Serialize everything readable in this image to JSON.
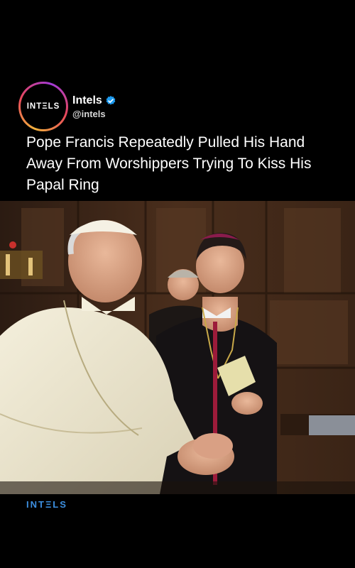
{
  "account": {
    "logo_text": "INTΞLS",
    "name": "Intels",
    "handle": "@intels",
    "verified_icon": "verified-badge-icon"
  },
  "post": {
    "headline": "Pope Francis Repeatedly Pulled His Hand Away From Worshippers Trying To Kiss His Papal Ring"
  },
  "footer": {
    "brand": "INTΞLS"
  },
  "colors": {
    "background": "#000000",
    "brand_blue": "#3d8fe0",
    "verified_blue": "#1d9bf0"
  }
}
